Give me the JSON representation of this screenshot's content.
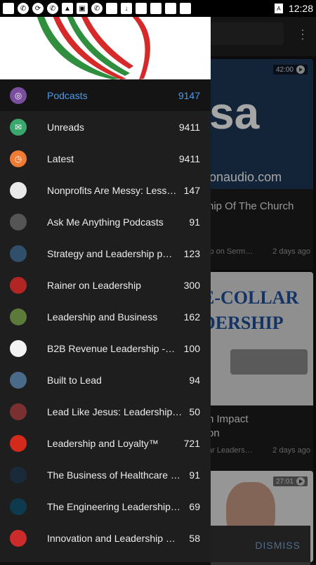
{
  "status_bar": {
    "time": "12:28"
  },
  "drawer": {
    "items": [
      {
        "label": "Podcasts",
        "count": "9147",
        "icon": "podcast-icon",
        "icon_bg": "#7a4e9e",
        "active": true
      },
      {
        "label": "Unreads",
        "count": "9411",
        "icon": "mail-icon",
        "icon_bg": "#3aa76d"
      },
      {
        "label": "Latest",
        "count": "9411",
        "icon": "clock-icon",
        "icon_bg": "#ef7b35"
      },
      {
        "label": "Nonprofits Are Messy: Lessons…",
        "count": "147",
        "icon": "podcast-artwork",
        "icon_bg": "#e9e9e9"
      },
      {
        "label": "Ask Me Anything Podcasts",
        "count": "91",
        "icon": "podcast-artwork",
        "icon_bg": "#555555"
      },
      {
        "label": "Strategy and Leadership podca…",
        "count": "123",
        "icon": "podcast-artwork",
        "icon_bg": "#2f4f6b"
      },
      {
        "label": "Rainer on Leadership",
        "count": "300",
        "icon": "podcast-artwork",
        "icon_bg": "#b22525"
      },
      {
        "label": "Leadership and Business",
        "count": "162",
        "icon": "podcast-artwork",
        "icon_bg": "#5c7a3a"
      },
      {
        "label": "B2B Revenue Leadership - CE…",
        "count": "100",
        "icon": "podcast-artwork",
        "icon_bg": "#f2f2f2"
      },
      {
        "label": "Built to Lead",
        "count": "94",
        "icon": "podcast-artwork",
        "icon_bg": "#4a6a8a"
      },
      {
        "label": "Lead Like Jesus: Leadership St…",
        "count": "50",
        "icon": "podcast-artwork",
        "icon_bg": "#7a3030"
      },
      {
        "label": "Leadership and Loyalty™",
        "count": "721",
        "icon": "podcast-artwork",
        "icon_bg": "#d42a1c"
      },
      {
        "label": "The Business of Healthcare Po…",
        "count": "91",
        "icon": "podcast-artwork",
        "icon_bg": "#1a2a3a"
      },
      {
        "label": "The Engineering Leadership Po…",
        "count": "69",
        "icon": "podcast-artwork",
        "icon_bg": "#0e3a4e"
      },
      {
        "label": "Innovation and Leadership with…",
        "count": "58",
        "icon": "podcast-artwork",
        "icon_bg": "#cc2b2b"
      }
    ]
  },
  "background": {
    "cards": [
      {
        "duration": "42:00",
        "artwork_text": "sa",
        "artwork_subtext": "onaudio.com",
        "title": "hip Of The Church",
        "meta_left": "ip on Serm…",
        "meta_right": "2 days ago"
      },
      {
        "artwork_text_1": "E-COLLAR",
        "artwork_text_2": "DERSHIP",
        "title": "h Impact\non",
        "meta_left": "ar Leaders…",
        "meta_right": "2 days ago"
      },
      {
        "duration": "27:01"
      }
    ],
    "snackbar": {
      "action": "DISMISS"
    }
  },
  "colors": {
    "accent": "#4d9be6",
    "drawer_bg": "#1e1e1e"
  }
}
